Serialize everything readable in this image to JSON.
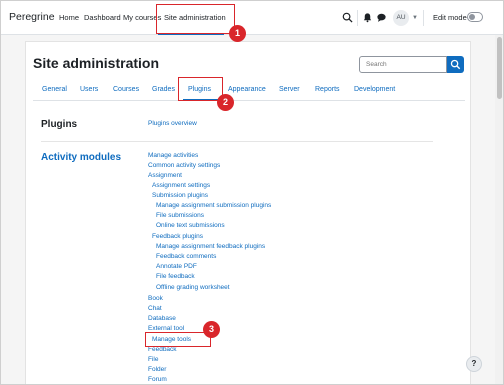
{
  "brand": "Peregrine",
  "topnav": [
    {
      "label": "Home"
    },
    {
      "label": "Dashboard"
    },
    {
      "label": "My courses"
    },
    {
      "label": "Site administration"
    }
  ],
  "user": {
    "initials": "AU"
  },
  "edit_mode": {
    "label": "Edit mode",
    "enabled": false
  },
  "page_title": "Site administration",
  "search": {
    "placeholder": "Search"
  },
  "tabs": [
    {
      "label": "General"
    },
    {
      "label": "Users"
    },
    {
      "label": "Courses"
    },
    {
      "label": "Grades"
    },
    {
      "label": "Plugins",
      "active": true
    },
    {
      "label": "Appearance"
    },
    {
      "label": "Server"
    },
    {
      "label": "Reports"
    },
    {
      "label": "Development"
    }
  ],
  "sections": {
    "plugins": {
      "heading": "Plugins",
      "links": [
        "Plugins overview"
      ]
    },
    "activity_modules": {
      "heading": "Activity modules",
      "links": [
        "Manage activities",
        "Common activity settings",
        "Assignment",
        "Assignment settings",
        "Submission plugins",
        "Manage assignment submission plugins",
        "File submissions",
        "Online text submissions",
        "Feedback plugins",
        "Manage assignment feedback plugins",
        "Feedback comments",
        "Annotate PDF",
        "File feedback",
        "Offline grading worksheet",
        "Book",
        "Chat",
        "Database",
        "External tool",
        "Manage tools",
        "Feedback",
        "File",
        "Folder",
        "Forum"
      ]
    }
  },
  "annotations": [
    "1",
    "2",
    "3"
  ],
  "help_label": "?",
  "colors": {
    "accent": "#0f6cbf",
    "annotation": "#d9262b"
  }
}
